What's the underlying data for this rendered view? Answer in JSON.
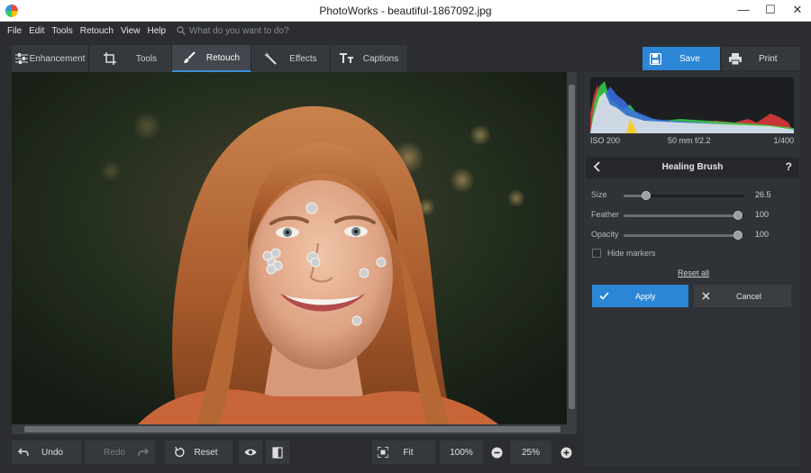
{
  "window": {
    "title": "PhotoWorks - beautiful-1867092.jpg",
    "controls": [
      "—",
      "☐",
      "✕"
    ]
  },
  "menu": {
    "items": [
      "File",
      "Edit",
      "Tools",
      "Retouch",
      "View",
      "Help"
    ],
    "search_placeholder": "What do you want to do?"
  },
  "tabs": [
    {
      "label": "Enhancement",
      "icon": "sliders-icon",
      "active": false
    },
    {
      "label": "Tools",
      "icon": "crop-icon",
      "active": false
    },
    {
      "label": "Retouch",
      "icon": "brush-icon",
      "active": true
    },
    {
      "label": "Effects",
      "icon": "magic-wand-icon",
      "active": false
    },
    {
      "label": "Captions",
      "icon": "text-icon",
      "active": false
    }
  ],
  "actions": {
    "save_label": "Save",
    "print_label": "Print"
  },
  "bottom_toolbar": {
    "undo_label": "Undo",
    "redo_label": "Redo",
    "reset_label": "Reset",
    "fit_label": "Fit",
    "zoom_100_label": "100%",
    "zoom_value": "25%"
  },
  "histogram": {
    "iso": "ISO 200",
    "lens": "50 mm f/2.2",
    "shutter": "1/400"
  },
  "panel": {
    "title": "Healing Brush",
    "help": "?",
    "sliders": [
      {
        "label": "Size",
        "value": "26.5",
        "level": 0.19
      },
      {
        "label": "Feather",
        "value": "100",
        "level": 0.95
      },
      {
        "label": "Opacity",
        "value": "100",
        "level": 0.95
      }
    ],
    "hide_markers_label": "Hide markers",
    "hide_markers_checked": false,
    "reset_all_label": "Reset all",
    "apply_label": "Apply",
    "cancel_label": "Cancel"
  },
  "colors": {
    "accent": "#2c86d6",
    "background": "#2b2d31",
    "panel": "#2f3236"
  }
}
